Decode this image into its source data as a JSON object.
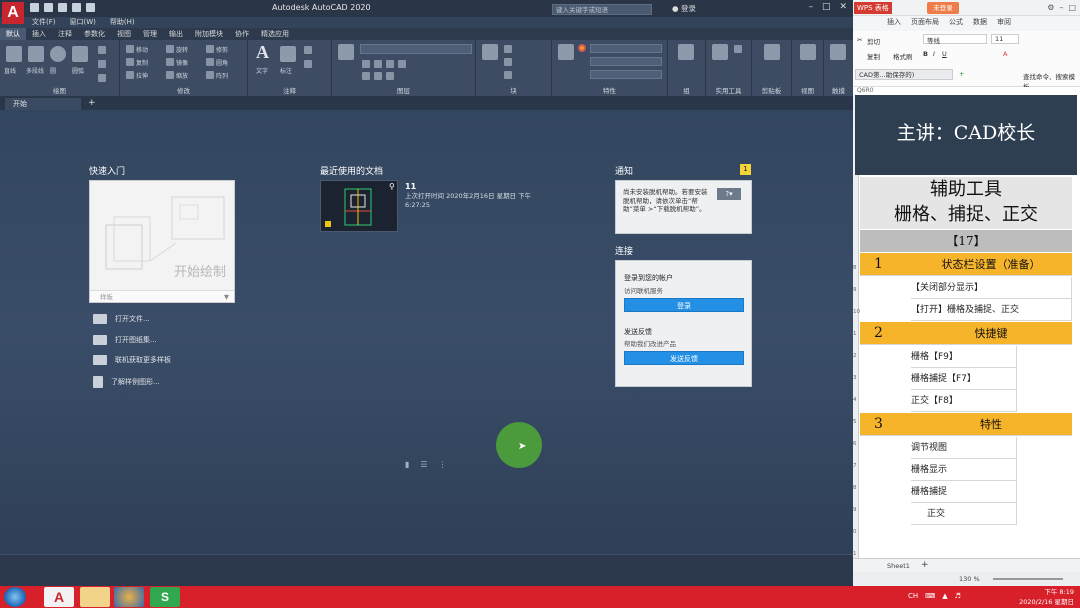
{
  "cad": {
    "title": "Autodesk AutoCAD 2020",
    "search_placeholder": "键入关键字或短语",
    "login": "登录",
    "menu": [
      "文件(F)",
      "窗口(W)",
      "帮助(H)"
    ],
    "ribbon_tabs": [
      "默认",
      "插入",
      "注释",
      "参数化",
      "视图",
      "管理",
      "输出",
      "附加模块",
      "协作",
      "精选应用"
    ],
    "ribbon_panels": [
      "绘图",
      "修改",
      "注释",
      "图层",
      "块",
      "特性",
      "组",
      "实用工具",
      "剪贴板",
      "视图",
      "触摸"
    ],
    "draw_tools": [
      "直线",
      "多段线",
      "圆",
      "圆弧"
    ],
    "modify_tools": [
      "移动",
      "旋转",
      "修剪",
      "复制",
      "镜像",
      "圆角",
      "拉伸",
      "缩放",
      "阵列"
    ],
    "annot_tools": [
      "文字",
      "标注"
    ],
    "file_tab": "开始",
    "start": {
      "quick_title": "快速入门",
      "start_drawing": "开始绘制",
      "template_label": "样板",
      "links": [
        "打开文件...",
        "打开图纸集...",
        "联机获取更多样板",
        "了解样例图形..."
      ],
      "recent_title": "最近使用的文档",
      "recent_name": "11",
      "recent_meta": "上次打开时间 2020年2月16日 星期日 下午 6:27:25",
      "notify_title": "通知",
      "notify_badge": "1",
      "notify_text": "尚未安装脱机帮助。若要安装脱机帮助，请依次单击“帮助”菜单 >“下载脱机帮助”。",
      "connect_title": "连接",
      "connect_account": "登录到您的帐户",
      "connect_service": "访问联机服务",
      "connect_login_btn": "登录",
      "feedback_title": "发送反馈",
      "feedback_sub": "帮助我们改进产品",
      "feedback_btn": "发送反馈"
    }
  },
  "wps": {
    "logo": "WPS 表格",
    "unlogged": "未登录",
    "tabs": [
      "插入",
      "页面布局",
      "公式",
      "数据",
      "审阅"
    ],
    "font_name": "等线",
    "font_size": "11",
    "cut": "剪切",
    "copy": "复制",
    "format_brush": "格式刷",
    "file_tab": "CAD第...助保存的)",
    "search_tools": "查找命令、搜索模板",
    "name_box": "Q6R0",
    "banner": "主讲：CAD校长",
    "heading1": "辅助工具",
    "heading2": "栅格、捕捉、正交",
    "lesson_no": "【17】",
    "sections": [
      {
        "num": "1",
        "title": "状态栏设置（准备）"
      },
      {
        "num": "2",
        "title": "快捷键"
      },
      {
        "num": "3",
        "title": "特性"
      }
    ],
    "rows_s1": [
      "【关闭部分显示】",
      "【打开】栅格及捕捉、正交"
    ],
    "rows_s2": [
      "栅格【F9】",
      "栅格捕捉【F7】",
      "正交【F8】"
    ],
    "rows_s3": [
      "调节视图",
      "栅格显示",
      "栅格捕捉",
      "正交"
    ],
    "row_numbers": [
      "8",
      "9",
      "10",
      "1",
      "2",
      "3",
      "4",
      "5",
      "6",
      "7",
      "8",
      "9",
      "0",
      "1",
      "2"
    ],
    "sheet_name": "Sheet1",
    "zoom": "130 %"
  },
  "taskbar": {
    "time": "下午 8:19",
    "date": "2020/2/16 星期日"
  },
  "colors": {
    "cad_bg": "#33465f",
    "accent_blue": "#2390e6",
    "section_yellow": "#f6b42a",
    "banner_dark": "#2e3f52",
    "taskbar_red": "#d8202a"
  }
}
